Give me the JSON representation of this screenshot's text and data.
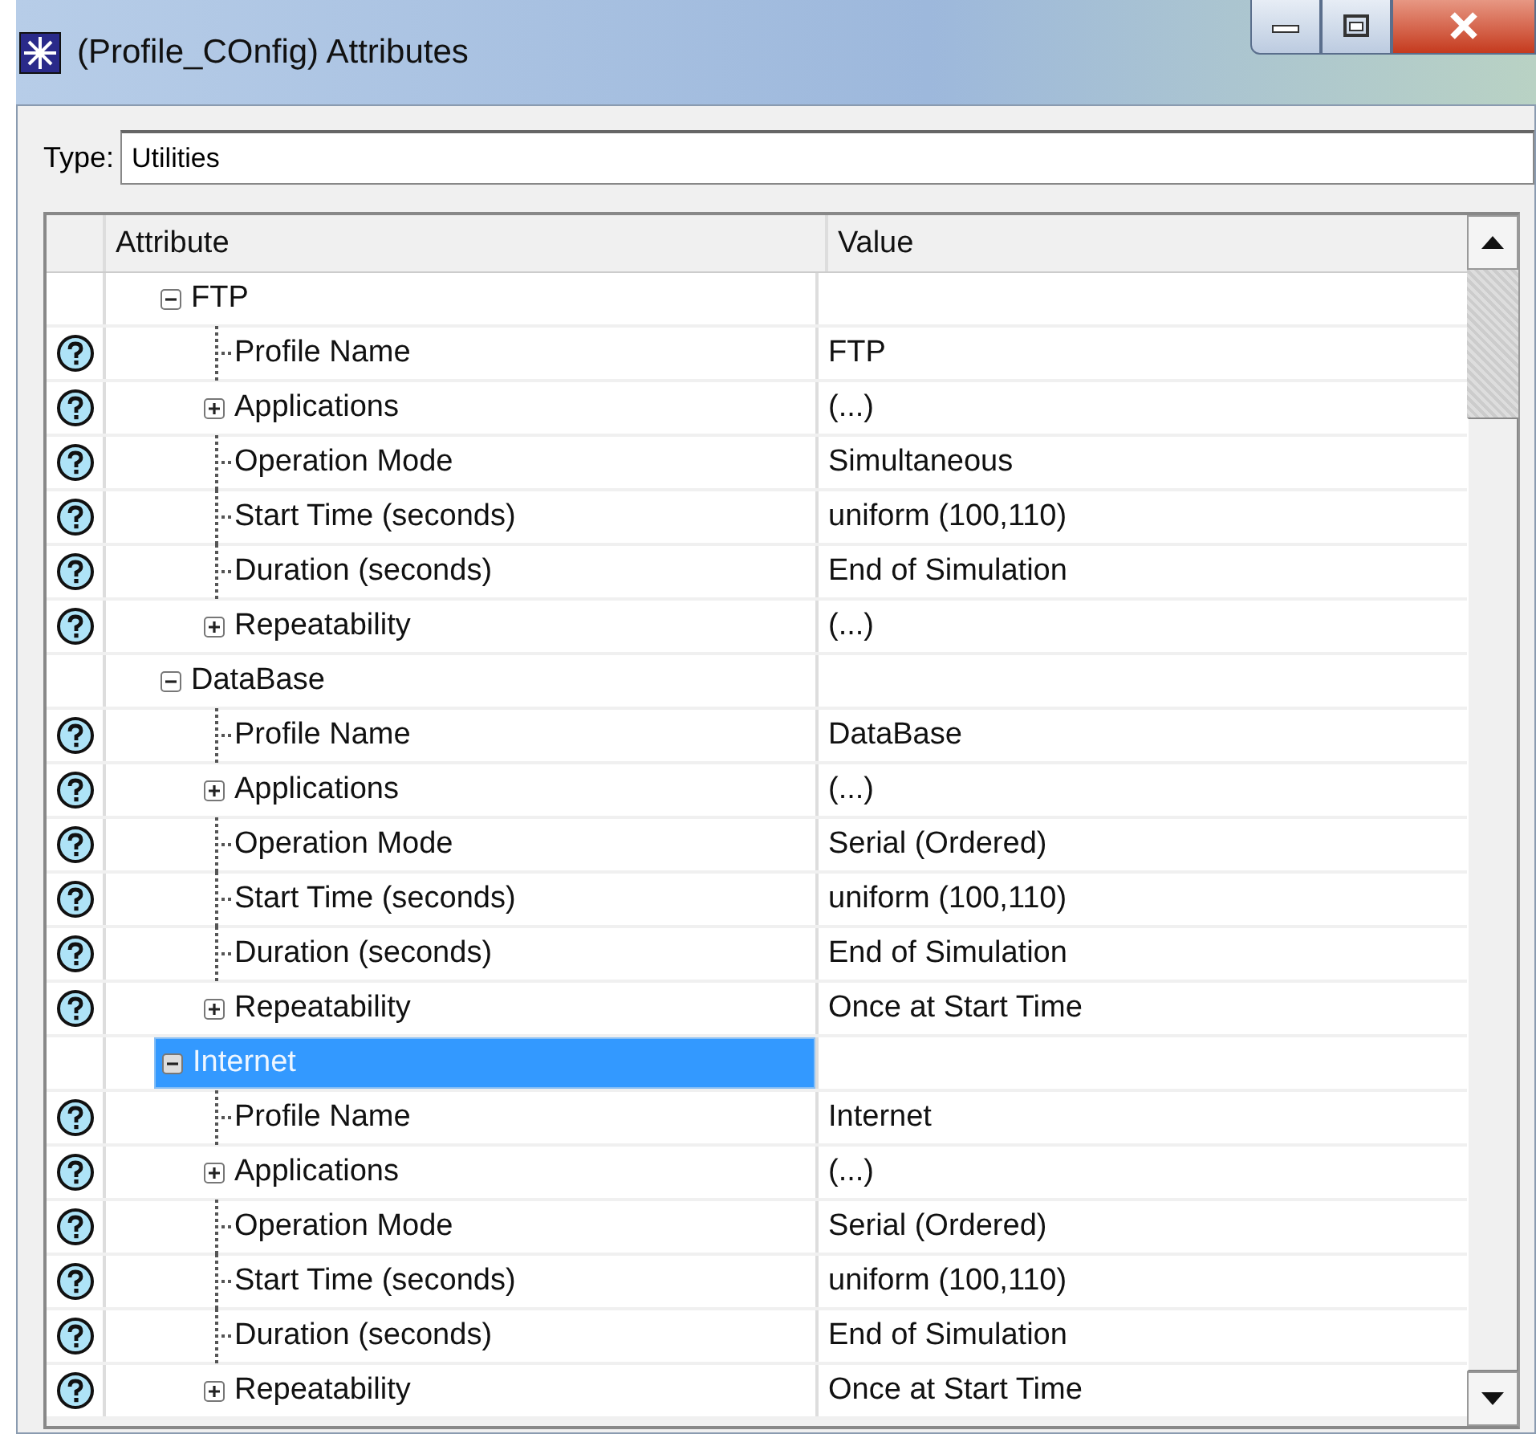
{
  "window": {
    "title": "(Profile_COnfig) Attributes"
  },
  "type_field": {
    "label": "Type:",
    "value": "Utilities"
  },
  "table": {
    "columns": [
      "Attribute",
      "Value"
    ],
    "groups": [
      {
        "name": "FTP",
        "expanded": true,
        "selected": false,
        "children": [
          {
            "kind": "leaf",
            "name": "Profile Name",
            "value": "FTP"
          },
          {
            "kind": "folder",
            "expanded": false,
            "name": "Applications",
            "value": "(...)"
          },
          {
            "kind": "leaf",
            "name": "Operation Mode",
            "value": "Simultaneous"
          },
          {
            "kind": "leaf",
            "name": "Start Time (seconds)",
            "value": "uniform (100,110)"
          },
          {
            "kind": "leaf",
            "name": "Duration (seconds)",
            "value": "End of Simulation"
          },
          {
            "kind": "folder",
            "expanded": false,
            "name": "Repeatability",
            "value": "(...)"
          }
        ]
      },
      {
        "name": "DataBase",
        "expanded": true,
        "selected": false,
        "children": [
          {
            "kind": "leaf",
            "name": "Profile Name",
            "value": "DataBase"
          },
          {
            "kind": "folder",
            "expanded": false,
            "name": "Applications",
            "value": "(...)"
          },
          {
            "kind": "leaf",
            "name": "Operation Mode",
            "value": "Serial (Ordered)"
          },
          {
            "kind": "leaf",
            "name": "Start Time (seconds)",
            "value": "uniform (100,110)"
          },
          {
            "kind": "leaf",
            "name": "Duration (seconds)",
            "value": "End of Simulation"
          },
          {
            "kind": "folder",
            "expanded": false,
            "name": "Repeatability",
            "value": "Once at Start Time"
          }
        ]
      },
      {
        "name": "Internet",
        "expanded": true,
        "selected": true,
        "children": [
          {
            "kind": "leaf",
            "name": "Profile Name",
            "value": "Internet"
          },
          {
            "kind": "folder",
            "expanded": false,
            "name": "Applications",
            "value": "(...)"
          },
          {
            "kind": "leaf",
            "name": "Operation Mode",
            "value": "Serial (Ordered)"
          },
          {
            "kind": "leaf",
            "name": "Start Time (seconds)",
            "value": "uniform (100,110)"
          },
          {
            "kind": "leaf",
            "name": "Duration (seconds)",
            "value": "End of Simulation"
          },
          {
            "kind": "folder",
            "expanded": false,
            "name": "Repeatability",
            "value": "Once at Start Time"
          }
        ]
      }
    ]
  }
}
